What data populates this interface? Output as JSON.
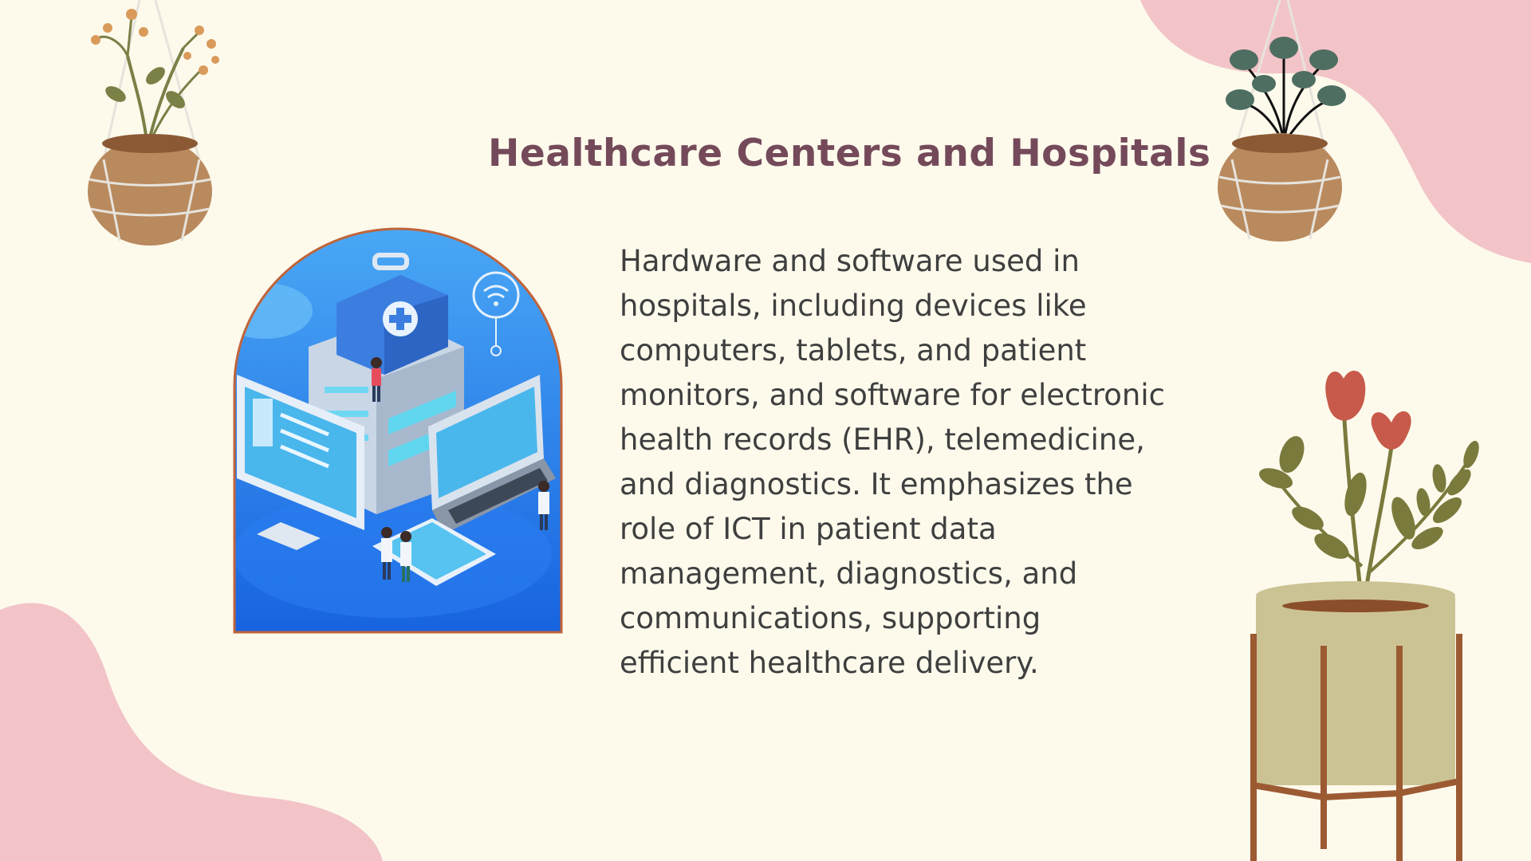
{
  "slide": {
    "title": "Healthcare Centers and Hospitals",
    "body": "Hardware and software used in\nhospitals, including devices like\ncomputers, tablets, and patient\nmonitors, and software for electronic\nhealth records (EHR), telemedicine,\nand diagnostics. It emphasizes the\nrole of ICT in patient data\nmanagement, diagnostics, and\ncommunications, supporting\nefficient healthcare delivery."
  },
  "colors": {
    "background": "#fdfaec",
    "title": "#744a5a",
    "body_text": "#3f3f3f",
    "blob": "#f2c4c8",
    "frame_border": "#c0643a",
    "illustration_blue": "#1e74e8"
  },
  "decorations": {
    "illustration": "healthcare-devices-illustration",
    "top_left": "hanging-plant-icon",
    "top_right": "hanging-plant-icon",
    "bottom_right": "potted-plant-on-stand-icon"
  }
}
